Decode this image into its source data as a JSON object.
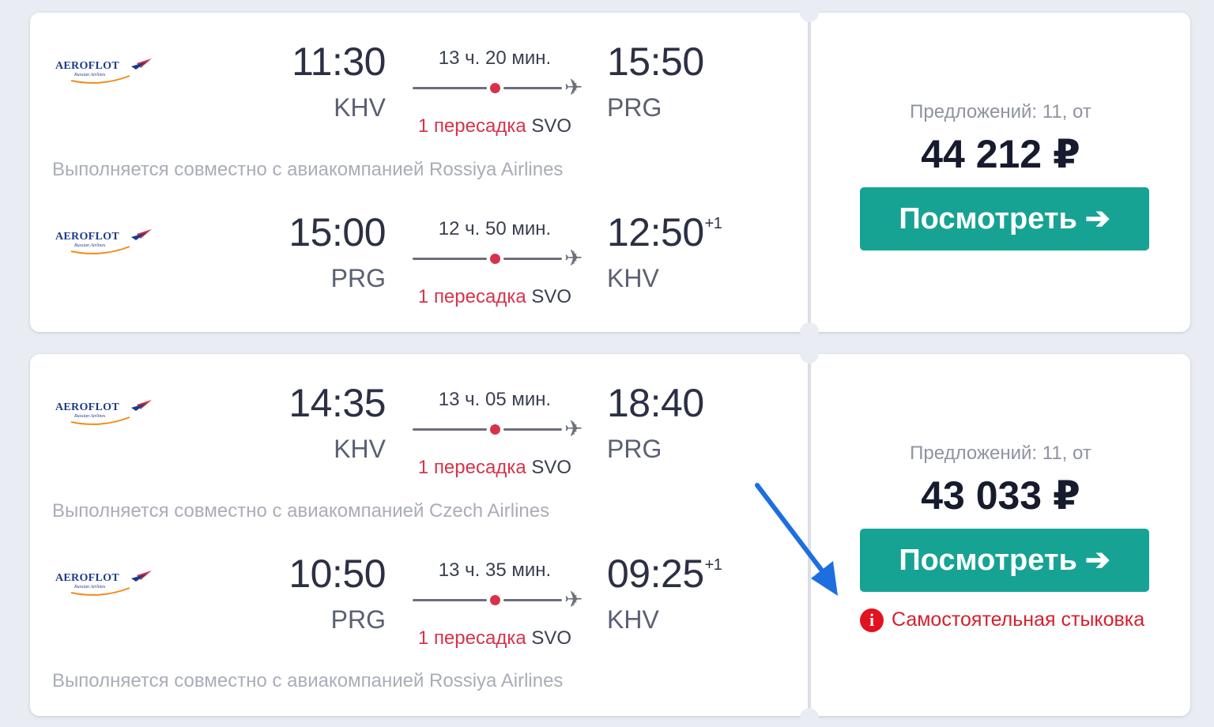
{
  "results": [
    {
      "offers_text": "Предложений: 11, от",
      "price": "44 212 ₽",
      "button_label": "Посмотреть",
      "warning": "",
      "segments": [
        {
          "airline": "AEROFLOT",
          "airline_sub": "Russian Airlines",
          "dep_time": "11:30",
          "dep_code": "KHV",
          "duration": "13 ч. 20 мин.",
          "stops": "1 пересадка",
          "stop_code": "SVO",
          "arr_time": "15:50",
          "arr_day_offset": "",
          "arr_code": "PRG",
          "operated_by": "Выполняется совместно с авиакомпанией Rossiya Airlines"
        },
        {
          "airline": "AEROFLOT",
          "airline_sub": "Russian Airlines",
          "dep_time": "15:00",
          "dep_code": "PRG",
          "duration": "12 ч. 50 мин.",
          "stops": "1 пересадка",
          "stop_code": "SVO",
          "arr_time": "12:50",
          "arr_day_offset": "+1",
          "arr_code": "KHV",
          "operated_by": ""
        }
      ]
    },
    {
      "offers_text": "Предложений: 11, от",
      "price": "43 033 ₽",
      "button_label": "Посмотреть",
      "warning": "Самостоятельная стыковка",
      "segments": [
        {
          "airline": "AEROFLOT",
          "airline_sub": "Russian Airlines",
          "dep_time": "14:35",
          "dep_code": "KHV",
          "duration": "13 ч. 05 мин.",
          "stops": "1 пересадка",
          "stop_code": "SVO",
          "arr_time": "18:40",
          "arr_day_offset": "",
          "arr_code": "PRG",
          "operated_by": "Выполняется совместно с авиакомпанией Czech Airlines"
        },
        {
          "airline": "AEROFLOT",
          "airline_sub": "Russian Airlines",
          "dep_time": "10:50",
          "dep_code": "PRG",
          "duration": "13 ч. 35 мин.",
          "stops": "1 пересадка",
          "stop_code": "SVO",
          "arr_time": "09:25",
          "arr_day_offset": "+1",
          "arr_code": "KHV",
          "operated_by": "Выполняется совместно с авиакомпанией Rossiya Airlines"
        }
      ]
    }
  ],
  "colors": {
    "accent_button": "#16a394",
    "stop_red": "#d6334a",
    "warning_red": "#d61f2c",
    "annotation_arrow": "#1d6fe0"
  },
  "icons": {
    "plane": "plane-icon",
    "warning": "exclamation-circle-icon",
    "arrow": "arrow-right-icon",
    "annotation": "annotation-arrow"
  }
}
